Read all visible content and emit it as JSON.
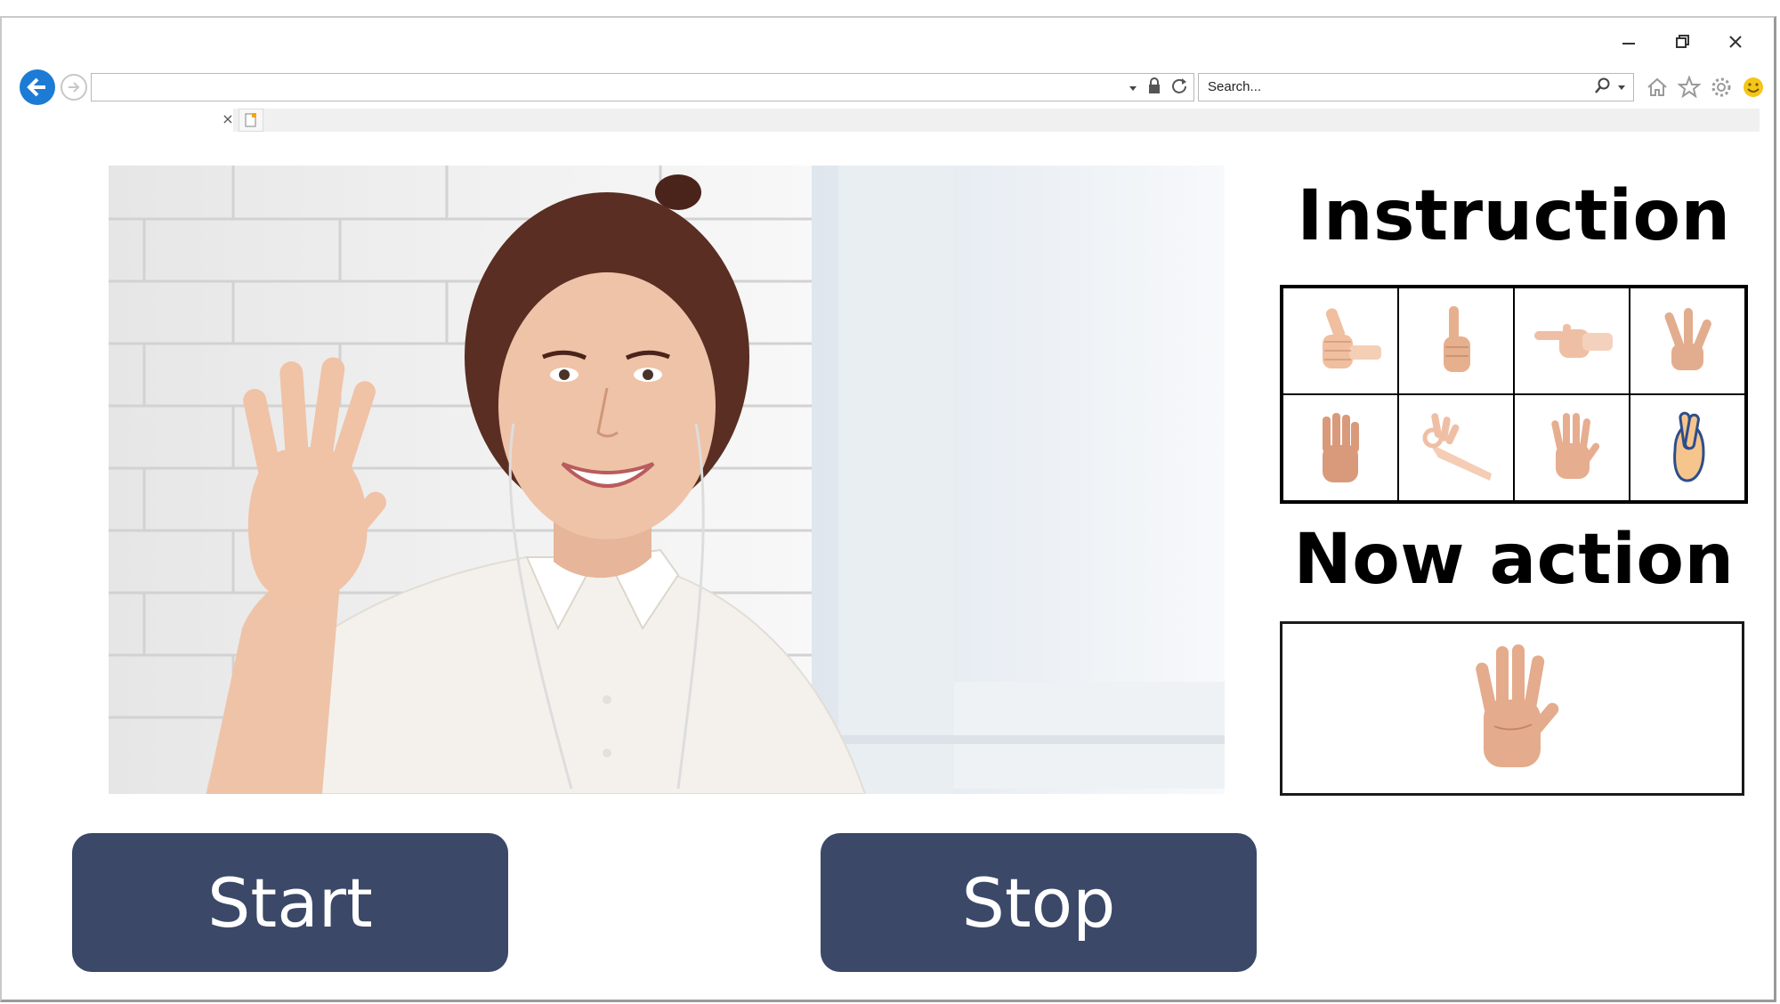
{
  "browser": {
    "address_value": "",
    "search_placeholder": "Search...",
    "tab_close": "×"
  },
  "panel": {
    "instruction_title": "Instruction",
    "now_action_title": "Now action",
    "gestures": [
      "thumbs-up",
      "index-finger-up",
      "pointing-finger",
      "three-fingers",
      "four-fingers",
      "ok-sign",
      "open-hand",
      "crossed-fingers"
    ],
    "current_gesture": "open-hand"
  },
  "controls": {
    "start_label": "Start",
    "stop_label": "Stop"
  },
  "colors": {
    "button_bg": "#3b4868",
    "button_text": "#ffffff",
    "back_button": "#1c7bd4"
  }
}
